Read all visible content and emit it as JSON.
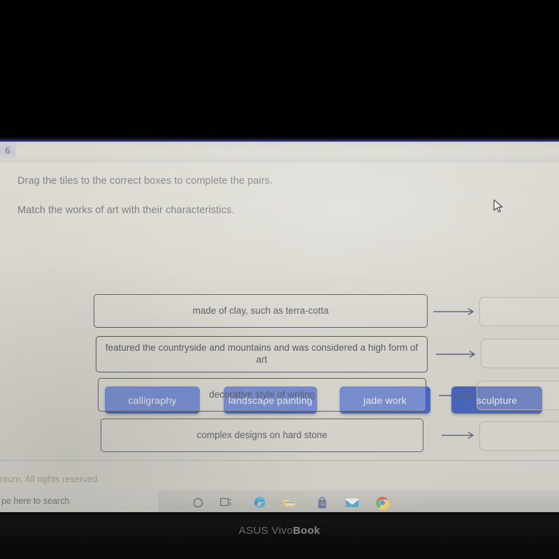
{
  "question": {
    "number": "6",
    "instruction_1": "Drag the tiles to the correct boxes to complete the pairs.",
    "instruction_2": "Match the works of art with their characteristics."
  },
  "tiles": [
    {
      "label": "calligraphy",
      "color": "#1543d6"
    },
    {
      "label": "landscape painting",
      "color": "#1a46d4"
    },
    {
      "label": "jade work",
      "color": "#1c48d2"
    },
    {
      "label": "sculpture",
      "color": "#2046b6"
    }
  ],
  "descriptions": [
    {
      "text": "made of clay, such as terra-cotta"
    },
    {
      "text": "featured the countryside and mountains and was considered a high form of art"
    },
    {
      "text": "decorative style of writing"
    },
    {
      "text": "complex designs on hard stone"
    }
  ],
  "drop_targets": [
    {
      "value": ""
    },
    {
      "value": ""
    },
    {
      "value": ""
    },
    {
      "value": ""
    }
  ],
  "footer": {
    "copyright": "ntum. All rights reserved."
  },
  "taskbar": {
    "search_placeholder": "pe here to search",
    "icons": [
      "cortana-circle-icon",
      "task-view-icon",
      "edge-browser-icon",
      "file-explorer-icon",
      "microsoft-store-icon",
      "mail-icon",
      "chrome-browser-icon"
    ]
  },
  "device": {
    "brand_light": "ASUS Vivo",
    "brand_bold": "Book"
  }
}
